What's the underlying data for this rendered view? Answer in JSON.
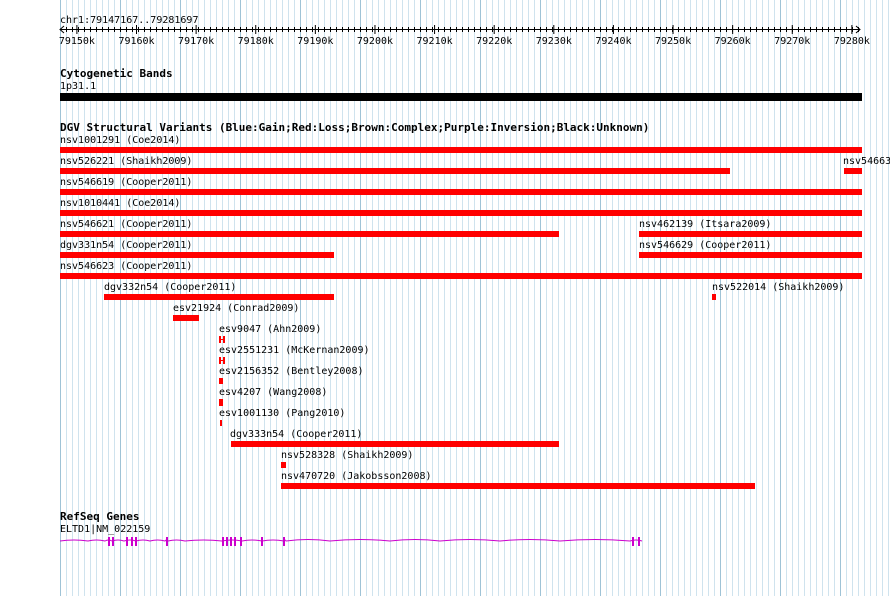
{
  "ruler": {
    "region": "chr1:79147167..79281697",
    "ticks": [
      "79150k",
      "79160k",
      "79170k",
      "79180k",
      "79190k",
      "79200k",
      "79210k",
      "79220k",
      "79230k",
      "79240k",
      "79250k",
      "79260k",
      "79270k",
      "79280k"
    ]
  },
  "cytoband": {
    "title": "Cytogenetic Bands",
    "band_label": "1p31.1"
  },
  "dgv": {
    "title": "DGV Structural Variants (Blue:Gain;Red:Loss;Brown:Complex;Purple:Inversion;Black:Unknown)",
    "loss_color": "#ff0000",
    "features": [
      {
        "id": "nsv1001291",
        "label": "nsv1001291 (Coe2014)"
      },
      {
        "id": "nsv526221",
        "label": "nsv526221 (Shaikh2009)"
      },
      {
        "id": "nsv54663",
        "label": "nsv54663"
      },
      {
        "id": "nsv546619",
        "label": "nsv546619 (Cooper2011)"
      },
      {
        "id": "nsv1010441",
        "label": "nsv1010441 (Coe2014)"
      },
      {
        "id": "nsv546621",
        "label": "nsv546621 (Cooper2011)"
      },
      {
        "id": "nsv462139",
        "label": "nsv462139 (Itsara2009)"
      },
      {
        "id": "dgv331n54",
        "label": "dgv331n54 (Cooper2011)"
      },
      {
        "id": "nsv546629",
        "label": "nsv546629 (Cooper2011)"
      },
      {
        "id": "nsv546623",
        "label": "nsv546623 (Cooper2011)"
      },
      {
        "id": "dgv332n54",
        "label": "dgv332n54 (Cooper2011)"
      },
      {
        "id": "nsv522014",
        "label": "nsv522014 (Shaikh2009)"
      },
      {
        "id": "esv21924",
        "label": "esv21924 (Conrad2009)"
      },
      {
        "id": "esv9047",
        "label": "esv9047 (Ahn2009)"
      },
      {
        "id": "esv2551231",
        "label": "esv2551231 (McKernan2009)"
      },
      {
        "id": "esv2156352",
        "label": "esv2156352 (Bentley2008)"
      },
      {
        "id": "esv4207",
        "label": "esv4207 (Wang2008)"
      },
      {
        "id": "esv1001130",
        "label": "esv1001130 (Pang2010)"
      },
      {
        "id": "dgv333n54",
        "label": "dgv333n54 (Cooper2011)"
      },
      {
        "id": "nsv528328",
        "label": "nsv528328 (Shaikh2009)"
      },
      {
        "id": "nsv470720",
        "label": "nsv470720 (Jakobsson2008)"
      }
    ]
  },
  "refseq": {
    "title": "RefSeq Genes",
    "gene_label": "ELTD1|NM_022159",
    "gene_color": "#cc00cc"
  }
}
